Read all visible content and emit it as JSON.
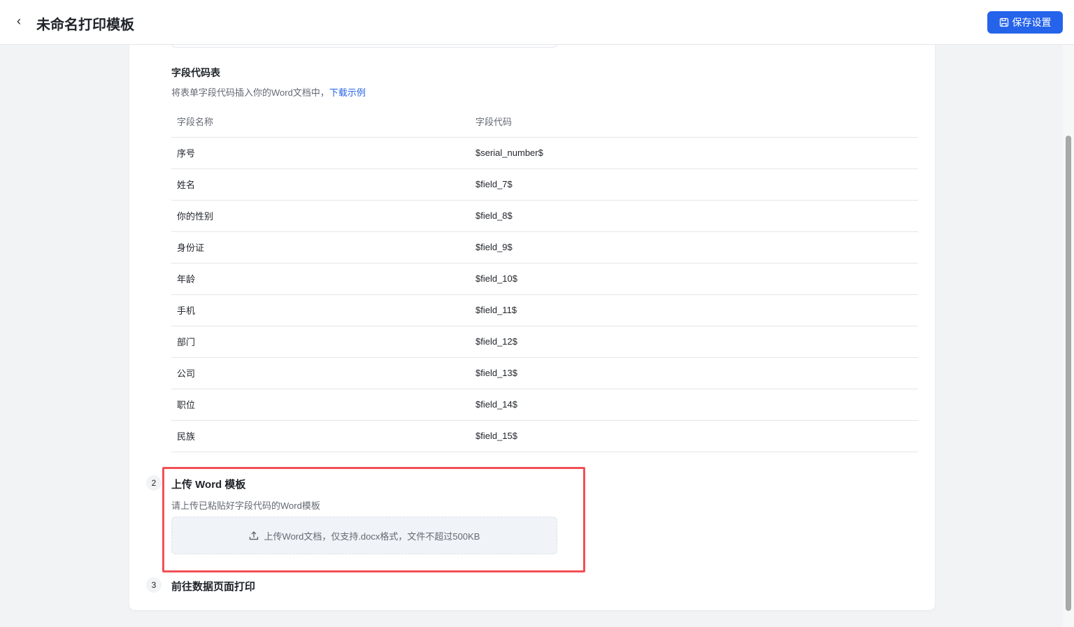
{
  "header": {
    "title": "未命名打印模板",
    "save_label": "保存设置"
  },
  "fields": {
    "title": "字段代码表",
    "desc": "将表单字段代码插入你的Word文档中，",
    "link": "下载示例",
    "columns": [
      "字段名称",
      "字段代码"
    ],
    "rows": [
      [
        "序号",
        "$serial_number$"
      ],
      [
        "姓名",
        "$field_7$"
      ],
      [
        "你的性别",
        "$field_8$"
      ],
      [
        "身份证",
        "$field_9$"
      ],
      [
        "年龄",
        "$field_10$"
      ],
      [
        "手机",
        "$field_11$"
      ],
      [
        "部门",
        "$field_12$"
      ],
      [
        "公司",
        "$field_13$"
      ],
      [
        "职位",
        "$field_14$"
      ],
      [
        "民族",
        "$field_15$"
      ]
    ]
  },
  "step2": {
    "num": "2",
    "title": "上传 Word 模板",
    "desc": "请上传已粘贴好字段代码的Word模板",
    "upload": "上传Word文档，仅支持.docx格式，文件不超过500KB"
  },
  "step3": {
    "num": "3",
    "title": "前往数据页面打印"
  }
}
